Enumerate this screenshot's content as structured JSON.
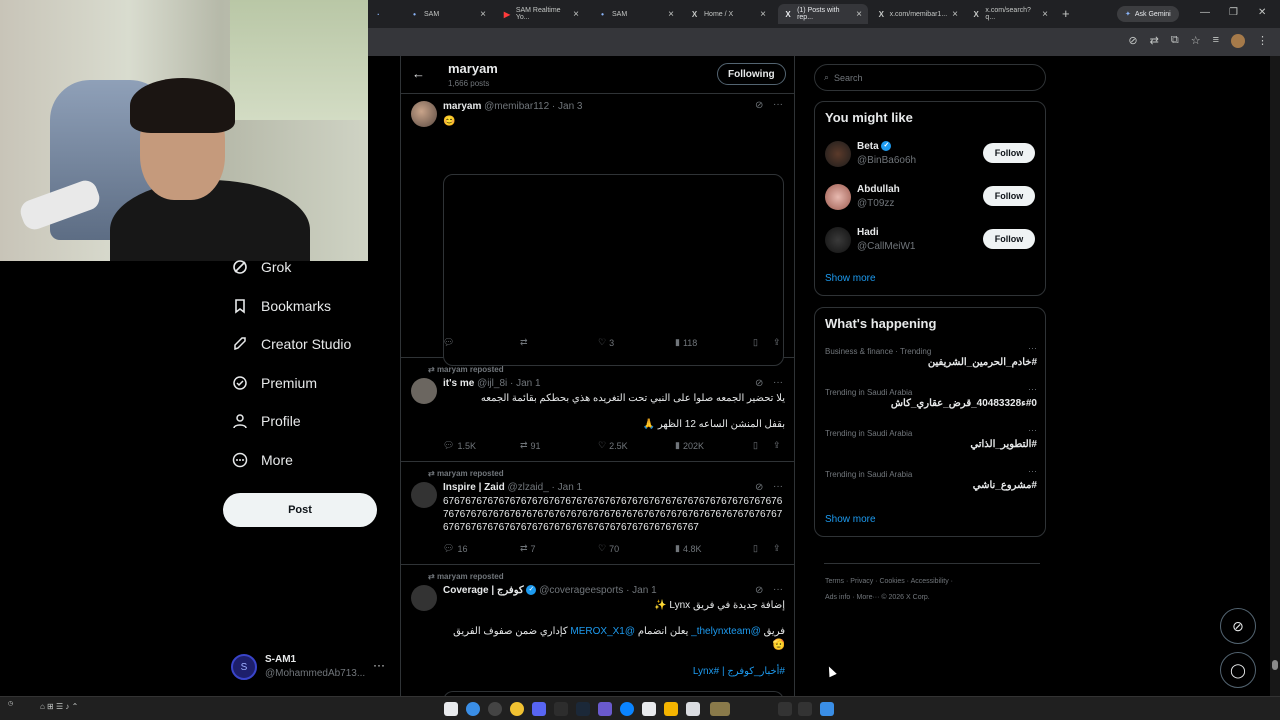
{
  "browser": {
    "tabs": [
      {
        "label": "",
        "icon": "generic-tab-icon"
      },
      {
        "label": "SAM",
        "icon": "sam-icon"
      },
      {
        "label": "SAM Realtime Yo...",
        "icon": "youtube-icon"
      },
      {
        "label": "SAM",
        "icon": "sam-icon"
      },
      {
        "label": "Home / X",
        "icon": "x-icon"
      },
      {
        "label": "(1) Posts with rep...",
        "icon": "x-icon"
      },
      {
        "label": "x.com/memibar1...",
        "icon": "x-icon"
      },
      {
        "label": "x.com/search?q...",
        "icon": "x-icon"
      }
    ],
    "ask_gemini": "Ask Gemini"
  },
  "nav": {
    "items": [
      {
        "label": "Grok",
        "icon": "grok-icon"
      },
      {
        "label": "Bookmarks",
        "icon": "bookmark-icon"
      },
      {
        "label": "Creator Studio",
        "icon": "rocket-icon"
      },
      {
        "label": "Premium",
        "icon": "premium-icon"
      },
      {
        "label": "Profile",
        "icon": "person-icon"
      },
      {
        "label": "More",
        "icon": "more-circle-icon"
      }
    ],
    "post_label": "Post",
    "account": {
      "name": "S-AM1",
      "handle": "@MohammedAb713..."
    }
  },
  "header": {
    "name": "maryam",
    "count": "1,666 posts",
    "following": "Following"
  },
  "posts": [
    {
      "repost": "",
      "name": "maryam",
      "handle": "@memibar112",
      "date": "· Jan 3",
      "text": "😊",
      "replies": "",
      "reposts": "",
      "likes": "3",
      "views": "118"
    },
    {
      "repost": "maryam reposted",
      "name": "it's me",
      "handle": "@ijl_8i",
      "date": "· Jan 1",
      "text": "يلا تحضير الجمعه صلوا على النبي تحت التغريده هذي بحطكم بقائمة الجمعه",
      "text2": "بقفل المنشن الساعه 12 الظهر 🙏",
      "replies": "1.5K",
      "reposts": "91",
      "likes": "2.5K",
      "views": "202K"
    },
    {
      "repost": "maryam reposted",
      "name": "Inspire | Zaid",
      "handle": "@zlzaid_",
      "date": "· Jan 1",
      "text": "676767676767676767676767676767676767676767676767676767676767676767676767676767676767676767676767676767676767676767676767676767676767676767676767676767676767676767676767",
      "replies": "16",
      "reposts": "7",
      "likes": "70",
      "views": "4.8K"
    },
    {
      "repost": "maryam reposted",
      "name": "Coverage | كوفرج",
      "handle": "@coverageesports",
      "date": "· Jan 1",
      "text": "إضافة جديدة في فريق Lynx ✨",
      "text2a": "فريق",
      "mention1": "@thelynxteam_",
      "text2b": "يعلن انضمام",
      "mention2": "@MEROX_X1",
      "text2c": "كإداري ضمن صفوف الفريق 🤩",
      "text3": "🫡",
      "tags": "#أخبار_كوفرج | #Lynx"
    }
  ],
  "right": {
    "search_placeholder": "Search",
    "you_might_like": "You might like",
    "suggestions": [
      {
        "name": "Beta",
        "handle": "@BinBa6o6h",
        "button": "Follow",
        "verified": true
      },
      {
        "name": "Abdullah",
        "handle": "@T09zz",
        "button": "Follow",
        "verified": false
      },
      {
        "name": "Hadi",
        "handle": "@CallMeiW1",
        "button": "Follow",
        "verified": false
      }
    ],
    "show_more": "Show more",
    "whats_happening": "What's happening",
    "trends": [
      {
        "context": "Business & finance · Trending",
        "title": "#خادم_الحرمين_الشريفين"
      },
      {
        "context": "Trending in Saudi Arabia",
        "title": "#0ء40483328_قرض_عقاري_كاش"
      },
      {
        "context": "Trending in Saudi Arabia",
        "title": "#التطوير_الذاتي"
      },
      {
        "context": "Trending in Saudi Arabia",
        "title": "#مشروع_ناشي"
      }
    ],
    "show_more2": "Show more",
    "footer1": "Terms · Privacy · Cookies · Accessibility ·",
    "footer2": "Ads info · More··· © 2026 X Corp."
  },
  "colors": {
    "accent": "#1d9bf0",
    "background": "#000000",
    "border": "#2f3336",
    "muted": "#71767b"
  }
}
